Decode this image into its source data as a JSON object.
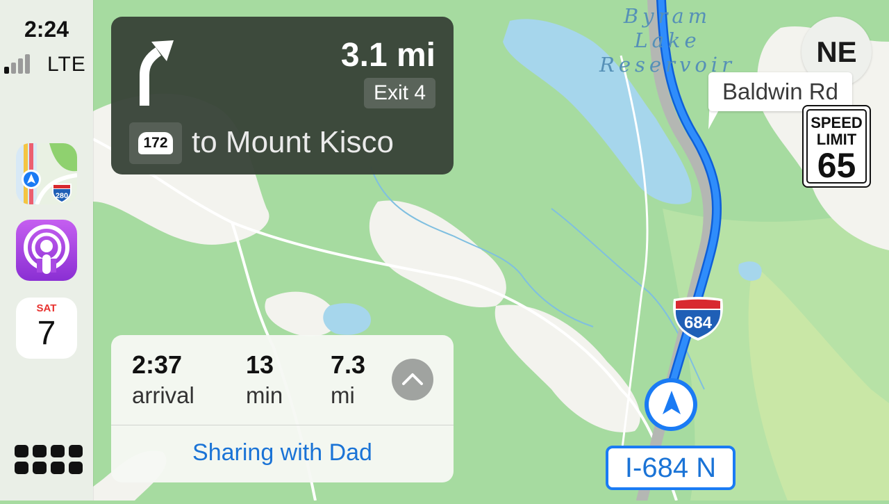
{
  "status_bar": {
    "time": "2:24",
    "network": "LTE",
    "signal_bars_active": 1,
    "signal_bars_total": 4
  },
  "sidebar": {
    "apps": [
      {
        "name": "Maps",
        "icon": "maps-icon",
        "badge": "280"
      },
      {
        "name": "Podcasts",
        "icon": "podcasts-icon"
      },
      {
        "name": "Calendar",
        "icon": "calendar-icon",
        "day": "SAT",
        "date": "7"
      }
    ],
    "dashboard_icon": "dashboard-grid-icon"
  },
  "guidance": {
    "maneuver": "slight-right-arrow",
    "distance": "3.1 mi",
    "exit": "Exit 4",
    "route_shield": "172",
    "destination": "to Mount Kisco"
  },
  "trip": {
    "arrival_time": "2:37",
    "arrival_label": "arrival",
    "duration": "13",
    "duration_unit": "min",
    "distance": "7.3",
    "distance_unit": "mi",
    "sharing": "Sharing with Dad"
  },
  "map": {
    "water_label": "Byram Lake Reservoir",
    "road_label": "Baldwin Rd",
    "compass": "NE",
    "speed_limit": {
      "label_1": "SPEED",
      "label_2": "LIMIT",
      "value": "65"
    },
    "interstate_shield": "684",
    "current_road": "I-684 N",
    "colors": {
      "land": "#a6dba0",
      "water": "#a6d6ec",
      "route": "#1a7bf4",
      "developed": "#f3f3ee"
    }
  }
}
